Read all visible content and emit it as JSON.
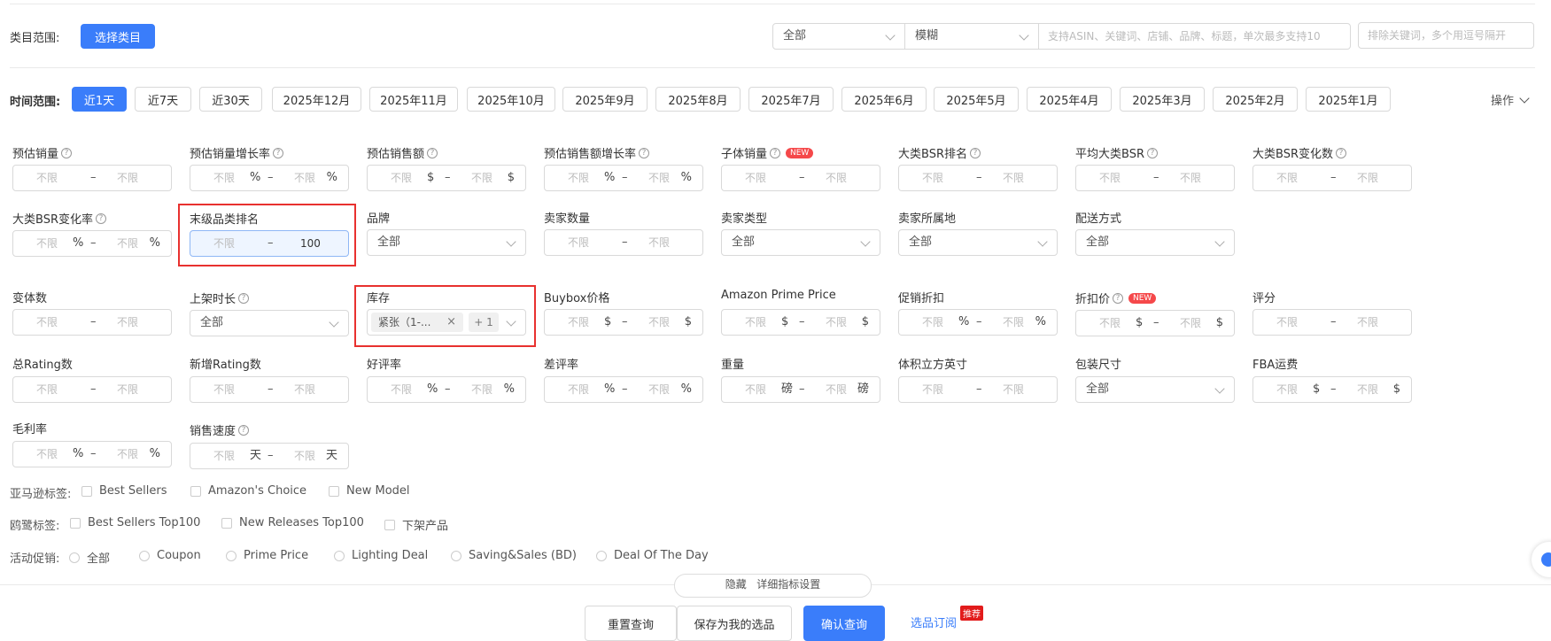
{
  "category": {
    "label": "类目范围:",
    "button": "选择类目"
  },
  "search": {
    "scope": "全部",
    "match": "模糊",
    "placeholder": "支持ASIN、关键词、店铺、品牌、标题，单次最多支持10",
    "exclude_placeholder": "排除关键词，多个用逗号隔开"
  },
  "time": {
    "label": "时间范围:",
    "options": [
      "近1天",
      "近7天",
      "近30天",
      "2025年12月",
      "2025年11月",
      "2025年10月",
      "2025年9月",
      "2025年8月",
      "2025年7月",
      "2025年6月",
      "2025年5月",
      "2025年4月",
      "2025年3月",
      "2025年2月",
      "2025年1月"
    ],
    "active": 0,
    "operate": "操作"
  },
  "placeholder": "不限",
  "units": {
    "percent": "%",
    "dollar": "$",
    "pound": "磅",
    "day": "天"
  },
  "filters": {
    "est_sales": "预估销量",
    "est_sales_growth": "预估销量增长率",
    "est_revenue": "预估销售额",
    "est_revenue_growth": "预估销售额增长率",
    "child_sales": "子体销量",
    "new_badge": "NEW",
    "bsr_rank": "大类BSR排名",
    "avg_bsr": "平均大类BSR",
    "bsr_change": "大类BSR变化数",
    "bsr_change_rate": "大类BSR变化率",
    "leaf_rank": "末级品类排名",
    "leaf_rank_max": "100",
    "brand": "品牌",
    "seller_count": "卖家数量",
    "seller_type": "卖家类型",
    "seller_location": "卖家所属地",
    "shipping": "配送方式",
    "all": "全部",
    "variants": "变体数",
    "listing_age": "上架时长",
    "inventory": "库存",
    "inventory_tag": "紧张（1-...",
    "inventory_more": "+ 1",
    "buybox": "Buybox价格",
    "prime_price": "Amazon Prime Price",
    "promo_discount": "促销折扣",
    "discount_price": "折扣价",
    "rating": "评分",
    "total_rating": "总Rating数",
    "new_rating": "新增Rating数",
    "good_rate": "好评率",
    "bad_rate": "差评率",
    "weight": "重量",
    "volume": "体积立方英寸",
    "package_size": "包装尺寸",
    "fba_fee": "FBA运费",
    "gross_margin": "毛利率",
    "sales_speed": "销售速度"
  },
  "tags": {
    "amazon_label": "亚马逊标签:",
    "amazon": [
      "Best Sellers",
      "Amazon's Choice",
      "New Model"
    ],
    "jj_label": "鸥鹭标签:",
    "jj": [
      "Best Sellers Top100",
      "New Releases Top100",
      "下架产品"
    ],
    "promo_label": "活动促销:",
    "promo": [
      "全部",
      "Coupon",
      "Prime Price",
      "Lighting Deal",
      "Saving&Sales (BD)",
      "Deal Of The Day"
    ]
  },
  "footer": {
    "toggle": "隐藏   详细指标设置",
    "reset": "重置查询",
    "save": "保存为我的选品",
    "confirm": "确认查询",
    "subscribe": "选品订阅",
    "recommend": "推荐"
  }
}
